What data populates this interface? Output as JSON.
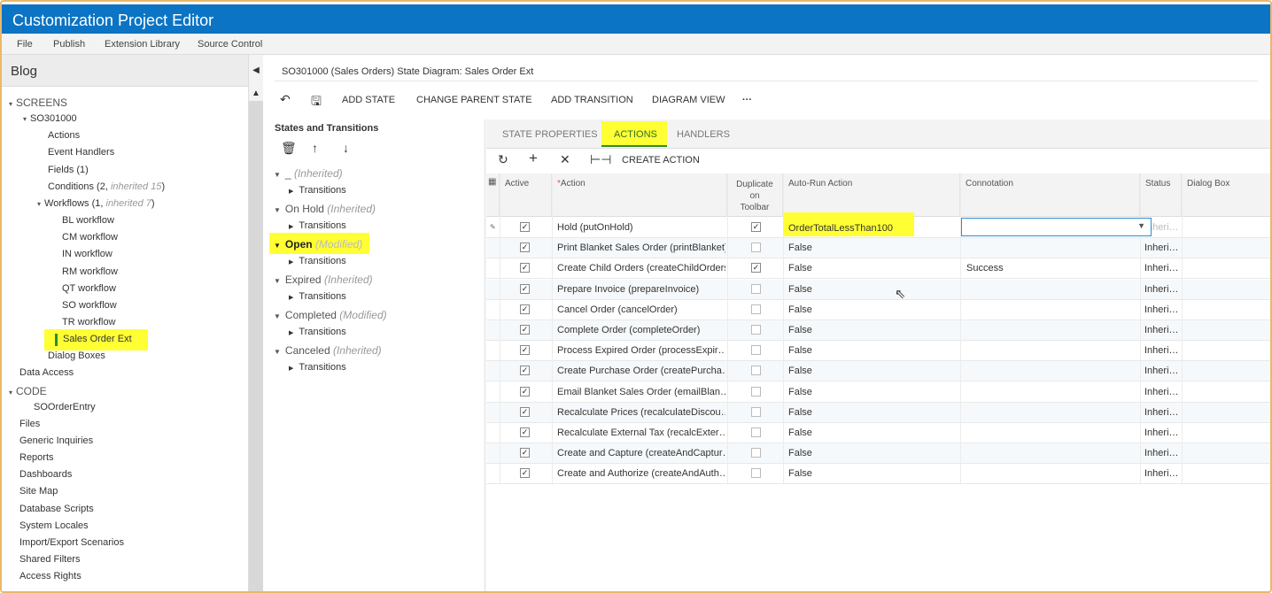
{
  "app": {
    "title": "Customization Project Editor",
    "menu": [
      "File",
      "Publish",
      "Extension Library",
      "Source Control"
    ]
  },
  "sidebar": {
    "project": "Blog",
    "items": [
      {
        "label": "SCREENS",
        "level": 0,
        "expand": "▾"
      },
      {
        "label": "SO301000",
        "level": 1,
        "expand": "▾"
      },
      {
        "label": "Actions",
        "level": 2
      },
      {
        "label": "Event Handlers",
        "level": 2
      },
      {
        "label": "Fields (1)",
        "level": 2
      },
      {
        "label": "Conditions (2, ",
        "inherited": "inherited 15",
        "suffix": ")",
        "level": 2
      },
      {
        "label": "Workflows (1, ",
        "inherited": "inherited 7",
        "suffix": ")",
        "level": 2,
        "expand": "▾"
      },
      {
        "label": "BL workflow",
        "level": 3
      },
      {
        "label": "CM workflow",
        "level": 3
      },
      {
        "label": "IN workflow",
        "level": 3
      },
      {
        "label": "RM workflow",
        "level": 3
      },
      {
        "label": "QT workflow",
        "level": 3
      },
      {
        "label": "SO workflow",
        "level": 3
      },
      {
        "label": "TR workflow",
        "level": 3
      },
      {
        "label": "Sales Order Ext",
        "level": 3,
        "selected": true
      },
      {
        "label": "Dialog Boxes",
        "level": 2
      },
      {
        "label": "Data Access",
        "level": 0
      },
      {
        "label": "CODE",
        "level": 0,
        "expand": "▾"
      },
      {
        "label": "SOOrderEntry",
        "level": 1
      },
      {
        "label": "Files",
        "level": 0
      },
      {
        "label": "Generic Inquiries",
        "level": 0
      },
      {
        "label": "Reports",
        "level": 0
      },
      {
        "label": "Dashboards",
        "level": 0
      },
      {
        "label": "Site Map",
        "level": 0
      },
      {
        "label": "Database Scripts",
        "level": 0
      },
      {
        "label": "System Locales",
        "level": 0
      },
      {
        "label": "Import/Export Scenarios",
        "level": 0
      },
      {
        "label": "Shared Filters",
        "level": 0
      },
      {
        "label": "Access Rights",
        "level": 0
      }
    ]
  },
  "main": {
    "title": "SO301000 (Sales Orders) State Diagram: Sales Order Ext",
    "toolbar": {
      "add_state": "ADD STATE",
      "change_parent_state": "CHANGE PARENT STATE",
      "add_transition": "ADD TRANSITION",
      "diagram_view": "DIAGRAM VIEW",
      "more": "···"
    }
  },
  "states_panel": {
    "title": "States and Transitions",
    "states": [
      {
        "name": "_",
        "tag": "(Inherited)",
        "transitions": "Transitions"
      },
      {
        "name": "On Hold",
        "tag": "(Inherited)",
        "transitions": "Transitions"
      },
      {
        "name": "Open",
        "tag": "(Modified)",
        "transitions": "Transitions",
        "highlighted": true
      },
      {
        "name": "Expired",
        "tag": "(Inherited)",
        "transitions": "Transitions"
      },
      {
        "name": "Completed",
        "tag": "(Modified)",
        "transitions": "Transitions"
      },
      {
        "name": "Canceled",
        "tag": "(Inherited)",
        "transitions": "Transitions"
      }
    ]
  },
  "tabs": [
    {
      "label": "STATE PROPERTIES",
      "active": false
    },
    {
      "label": "ACTIONS",
      "active": true
    },
    {
      "label": "HANDLERS",
      "active": false
    }
  ],
  "grid_toolbar": {
    "create_action": "CREATE ACTION"
  },
  "grid": {
    "columns": {
      "active": "Active",
      "action": "Action",
      "duplicate": "Duplicate on Toolbar",
      "duplicate_lines": [
        "Duplicate",
        "on",
        "Toolbar"
      ],
      "autorun": "Auto-Run Action",
      "connotation": "Connotation",
      "status": "Status",
      "dialog": "Dialog Box"
    },
    "rows": [
      {
        "active": true,
        "action": "Hold (putOnHold)",
        "duplicate": true,
        "autorun": "OrderTotalLessThan100",
        "connotation": "",
        "status": "Inheri…",
        "editing": true
      },
      {
        "active": true,
        "action": "Print Blanket Sales Order (printBlanket)",
        "duplicate": false,
        "autorun": "False",
        "connotation": "",
        "status": "Inheri…"
      },
      {
        "active": true,
        "action": "Create Child Orders (createChildOrders)",
        "duplicate": true,
        "autorun": "False",
        "connotation": "Success",
        "status": "Inheri…"
      },
      {
        "active": true,
        "action": "Prepare Invoice (prepareInvoice)",
        "duplicate": false,
        "autorun": "False",
        "connotation": "",
        "status": "Inheri…"
      },
      {
        "active": true,
        "action": "Cancel Order (cancelOrder)",
        "duplicate": false,
        "autorun": "False",
        "connotation": "",
        "status": "Inheri…"
      },
      {
        "active": true,
        "action": "Complete Order (completeOrder)",
        "duplicate": false,
        "autorun": "False",
        "connotation": "",
        "status": "Inheri…"
      },
      {
        "active": true,
        "action": "Process Expired Order (processExpir…",
        "duplicate": false,
        "autorun": "False",
        "connotation": "",
        "status": "Inheri…"
      },
      {
        "active": true,
        "action": "Create Purchase Order (createPurcha…",
        "duplicate": false,
        "autorun": "False",
        "connotation": "",
        "status": "Inheri…"
      },
      {
        "active": true,
        "action": "Email Blanket Sales Order (emailBlan…",
        "duplicate": false,
        "autorun": "False",
        "connotation": "",
        "status": "Inheri…"
      },
      {
        "active": true,
        "action": "Recalculate Prices (recalculateDiscou…",
        "duplicate": false,
        "autorun": "False",
        "connotation": "",
        "status": "Inheri…"
      },
      {
        "active": true,
        "action": "Recalculate External Tax (recalcExter…",
        "duplicate": false,
        "autorun": "False",
        "connotation": "",
        "status": "Inheri…"
      },
      {
        "active": true,
        "action": "Create and Capture (createAndCaptur…",
        "duplicate": false,
        "autorun": "False",
        "connotation": "",
        "status": "Inheri…"
      },
      {
        "active": true,
        "action": "Create and Authorize (createAndAuth…",
        "duplicate": false,
        "autorun": "False",
        "connotation": "",
        "status": "Inheri…"
      }
    ]
  },
  "colors": {
    "accent": "#0b74c4",
    "highlight": "#ffff33",
    "frame": "#e8b96a"
  }
}
